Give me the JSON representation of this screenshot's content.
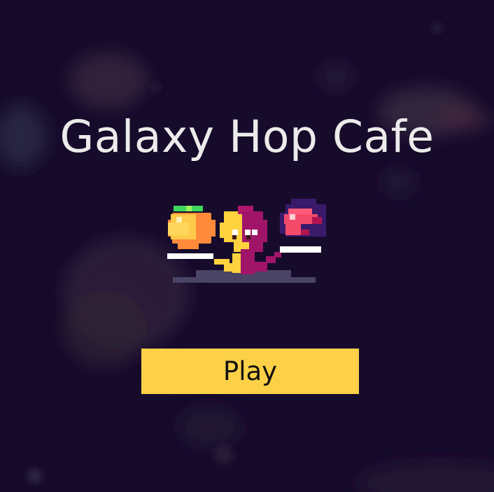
{
  "game": {
    "title": "Galaxy Hop Cafe",
    "play_label": "Play"
  },
  "colors": {
    "background": "#170b2c",
    "title": "#ebebeb",
    "button": "#fdd147",
    "button_text": "#111111"
  },
  "icons": {
    "mascot": "cafe-characters-pixel-art",
    "orange": "orange-fruit-icon",
    "blob": "yellow-purple-blob-character-icon",
    "bird": "red-bird-icon"
  }
}
